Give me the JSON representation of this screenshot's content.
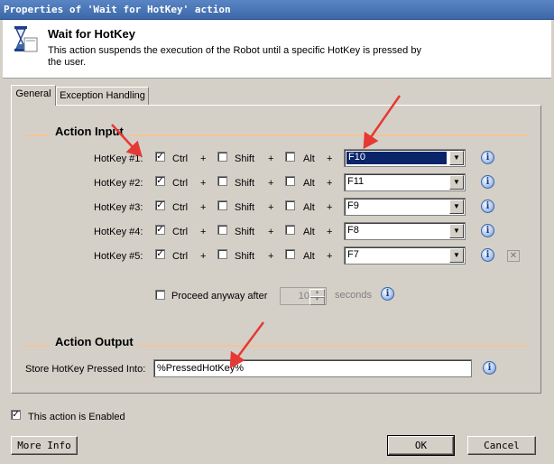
{
  "window": {
    "title": "Properties of 'Wait for HotKey' action"
  },
  "header": {
    "title": "Wait for HotKey",
    "description": "This action suspends the execution of the Robot until a specific HotKey is pressed by the user.",
    "icon": "hourglass-icon"
  },
  "tabs": [
    {
      "label": "General"
    },
    {
      "label": "Exception Handling"
    }
  ],
  "action_input": {
    "title": "Action Input",
    "plus": "+",
    "hotkeys": [
      {
        "label": "HotKey #1:",
        "ctrl": {
          "label": "Ctrl",
          "checked": true
        },
        "shift": {
          "label": "Shift",
          "checked": false
        },
        "alt": {
          "label": "Alt",
          "checked": false
        },
        "key": "F10"
      },
      {
        "label": "HotKey #2:",
        "ctrl": {
          "label": "Ctrl",
          "checked": true
        },
        "shift": {
          "label": "Shift",
          "checked": false
        },
        "alt": {
          "label": "Alt",
          "checked": false
        },
        "key": "F11"
      },
      {
        "label": "HotKey #3:",
        "ctrl": {
          "label": "Ctrl",
          "checked": true
        },
        "shift": {
          "label": "Shift",
          "checked": false
        },
        "alt": {
          "label": "Alt",
          "checked": false
        },
        "key": "F9"
      },
      {
        "label": "HotKey #4:",
        "ctrl": {
          "label": "Ctrl",
          "checked": true
        },
        "shift": {
          "label": "Shift",
          "checked": false
        },
        "alt": {
          "label": "Alt",
          "checked": false
        },
        "key": "F8"
      },
      {
        "label": "HotKey #5:",
        "ctrl": {
          "label": "Ctrl",
          "checked": true
        },
        "shift": {
          "label": "Shift",
          "checked": false
        },
        "alt": {
          "label": "Alt",
          "checked": false
        },
        "key": "F7"
      }
    ],
    "proceed": {
      "label": "Proceed anyway after",
      "checked": false,
      "value": "10",
      "unit": "seconds"
    }
  },
  "action_output": {
    "title": "Action Output",
    "store_label": "Store HotKey Pressed Into:",
    "store_value": "%PressedHotKey%"
  },
  "enabled": {
    "label": "This action is Enabled",
    "checked": true
  },
  "buttons": {
    "more_info": "More Info",
    "ok": "OK",
    "cancel": "Cancel"
  },
  "colors": {
    "titlebar": "#3b68a8",
    "section_line": "#f3c596",
    "selection": "#0a246a",
    "annotation_arrow": "#e53935"
  }
}
